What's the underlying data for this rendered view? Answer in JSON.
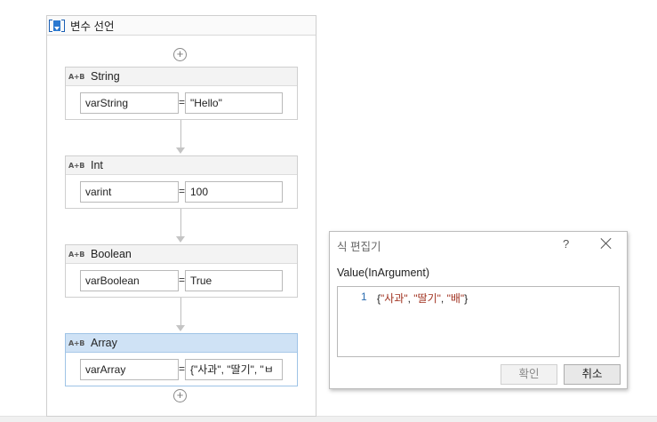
{
  "sequence": {
    "title": "변수 선언"
  },
  "activities": [
    {
      "type": "String",
      "variable": "varString",
      "operator": "=",
      "value": "\"Hello\""
    },
    {
      "type": "Int",
      "variable": "varint",
      "operator": "=",
      "value": "100"
    },
    {
      "type": "Boolean",
      "variable": "varBoolean",
      "operator": "=",
      "value": "True"
    },
    {
      "type": "Array",
      "variable": "varArray",
      "operator": "=",
      "value": "{\"사과\", \"딸기\", \"ㅂ"
    }
  ],
  "icons": {
    "activity": "A+B",
    "sequence": "sequence-icon",
    "add": "+"
  },
  "dialog": {
    "title": "식 편집기",
    "help": "?",
    "label": "Value(InArgument)",
    "line_number": "1",
    "code": {
      "open": "{",
      "item1": "\"사과\"",
      "sep1": ", ",
      "item2": "\"딸기\"",
      "sep2": ", ",
      "item3": "\"배\"",
      "close": "}"
    },
    "ok_label": "확인",
    "cancel_label": "취소"
  },
  "colors": {
    "selected_header": "#cfe2f5",
    "string_literal": "#a0311f",
    "line_number": "#2b6cb0"
  }
}
